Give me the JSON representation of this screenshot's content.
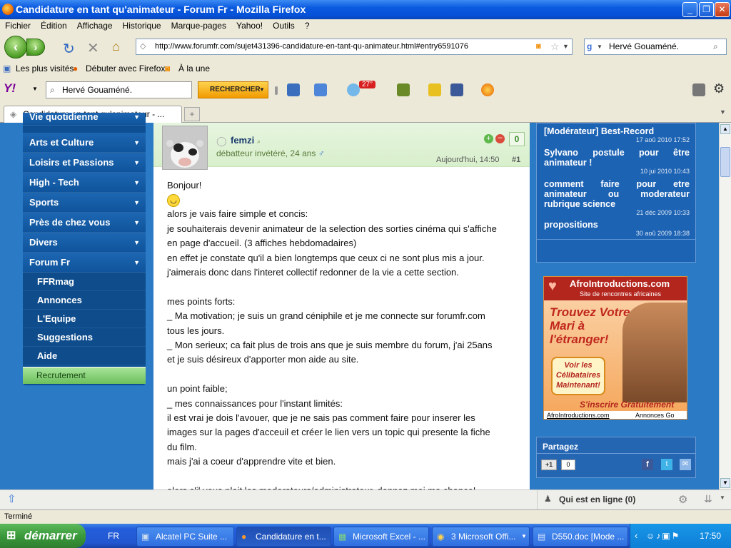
{
  "window": {
    "title": "Candidature en tant qu'animateur - Forum Fr - Mozilla Firefox"
  },
  "menu": [
    "Fichier",
    "Édition",
    "Affichage",
    "Historique",
    "Marque-pages",
    "Yahoo!",
    "Outils",
    "?"
  ],
  "nav": {
    "url": "http://www.forumfr.com/sujet431396-candidature-en-tant-qu-animateur.html#entry6591076",
    "search_value": "Hervé Gouaméné."
  },
  "bookmarks": [
    "Les plus visités",
    "Débuter avec Firefox",
    "À la une"
  ],
  "yahoo": {
    "search_value": "Hervé Gouaméné.",
    "search_button": "RECHERCHER",
    "weather_badge": "27°"
  },
  "tab": {
    "title": "Candidature en tant qu'animateur - ..."
  },
  "sidebar": {
    "top_partial": "Vie quotidienne",
    "items": [
      "Arts et Culture",
      "Loisirs et Passions",
      "High - Tech",
      "Sports",
      "Près de chez vous",
      "Divers",
      "Forum Fr"
    ],
    "subitems": [
      "FFRmag",
      "Annonces",
      "L'Equipe",
      "Suggestions",
      "Aide"
    ],
    "recruit": "Recrutement"
  },
  "post": {
    "author": "femzi",
    "author_meta": "débatteur invétéré, 24 ans",
    "reputation": "0",
    "date": "Aujourd'hui, 14:50",
    "number": "#1",
    "lines": [
      "Bonjour!",
      "",
      "alors je vais faire simple et concis:",
      "je souhaiterais devenir animateur de la selection des sorties cinéma qui s'affiche",
      "en page d'accueil. (3 affiches hebdomadaires)",
      "en effet je constate qu'il a bien longtemps que ceux ci ne sont plus mis a jour.",
      "j'aimerais donc dans l'interet collectif redonner de la vie a cette section.",
      " ",
      "mes points forts:",
      "_ Ma motivation; je suis un grand céniphile et je me connecte sur forumfr.com",
      "tous les jours.",
      "_ Mon serieux; ca fait plus de trois ans que je suis membre du forum, j'ai 25ans",
      "et je suis désireux d'apporter mon aide au site.",
      " ",
      "un point faible;",
      "_ mes connaissances pour l'instant limités:",
      "il est vrai je dois l'avouer, que je ne sais pas comment faire pour inserer les",
      "images sur la pages d'acceuil et créer le lien vers un topic qui presente la fiche",
      "du film.",
      "mais j'ai a coeur d'apprendre vite et bien.",
      " ",
      "alors s'il vous plait les moderateurs/administrateur, donnez moi ma chance!"
    ]
  },
  "related": [
    {
      "title": "[Modérateur] Best-Record",
      "date": "17 aoû 2010 17:52"
    },
    {
      "title": "Sylvano postule pour être animateur !",
      "date": "10 jui 2010 10:43"
    },
    {
      "title": "comment faire pour etre animateur ou moderateur rubrique science",
      "date": "21 déc 2009 10:33"
    },
    {
      "title": "propositions",
      "date": "30 aoû 2009 18:38"
    }
  ],
  "ad": {
    "brand": "AfroIntroductions.com",
    "tagline": "Site de rencontres africaines",
    "headline": "Trouvez Votre Mari à l'étranger!",
    "cta": "Voir les Célibataires Maintenant!",
    "signup": "S'inscrire Gratuitement",
    "footer_left": "AfroIntroductions.com",
    "footer_right": "Annonces Go"
  },
  "share": {
    "title": "Partagez",
    "plus_one": "+1",
    "count": "0"
  },
  "online": "Qui est en ligne (0)",
  "status": "Terminé",
  "taskbar": {
    "start": "démarrer",
    "lang": "FR",
    "tasks": [
      "Alcatel PC Suite ...",
      "Candidature en t...",
      "Microsoft Excel - ...",
      "3 Microsoft Offi...",
      "D550.doc [Mode ..."
    ],
    "clock": "17:50"
  }
}
